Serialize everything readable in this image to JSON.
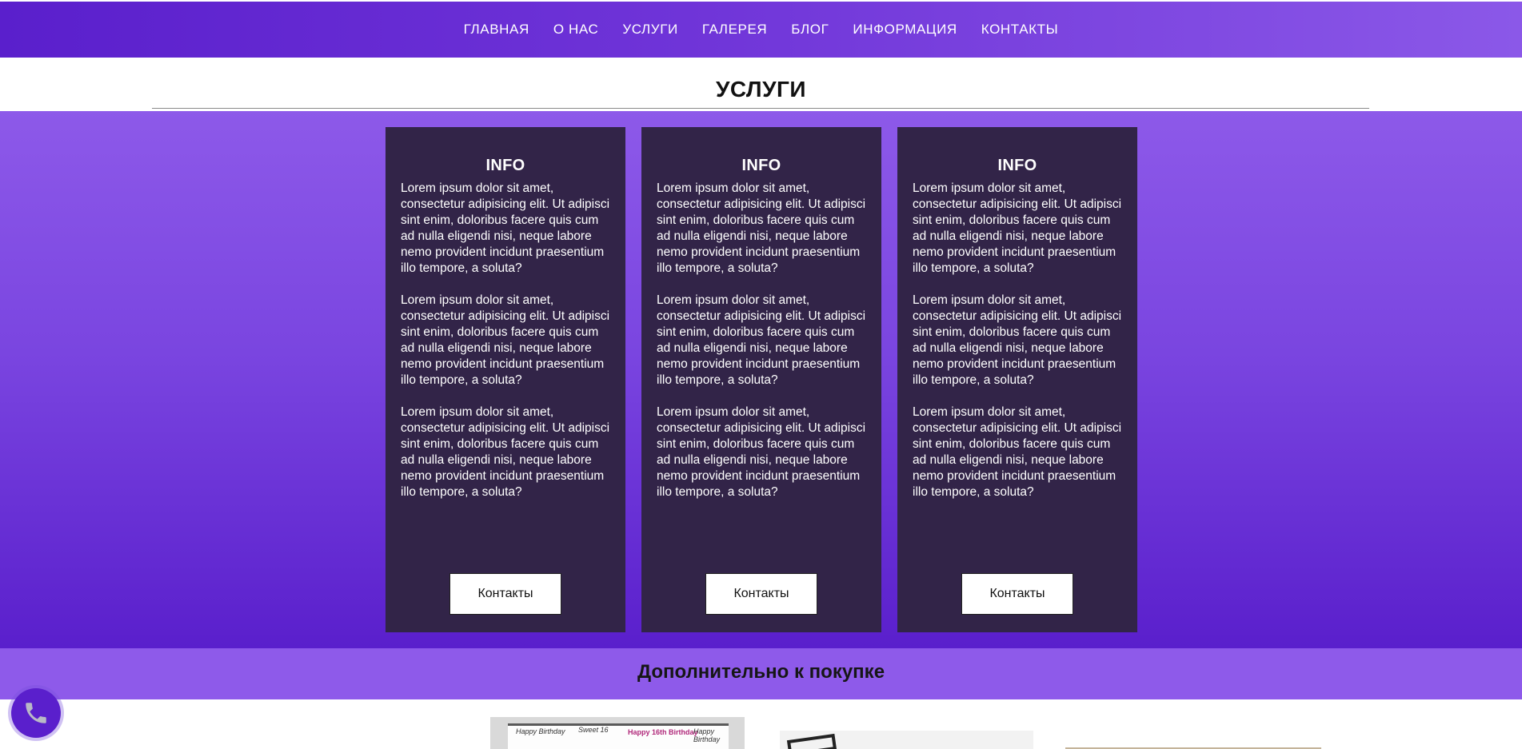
{
  "nav": {
    "items": [
      "ГЛАВНАЯ",
      "О НАС",
      "УСЛУГИ",
      "ГАЛЕРЕЯ",
      "БЛОГ",
      "ИНФОРМАЦИЯ",
      "КОНТАКТЫ"
    ]
  },
  "page": {
    "title": "УСЛУГИ"
  },
  "cards": [
    {
      "title": "INFO",
      "paragraphs": [
        "Lorem ipsum dolor sit amet, consectetur adipisicing elit. Ut adipisci sint enim, doloribus facere quis cum ad nulla eligendi nisi, neque labore nemo provident incidunt praesentium illo tempore, a soluta?",
        "Lorem ipsum dolor sit amet, consectetur adipisicing elit. Ut adipisci sint enim, doloribus facere quis cum ad nulla eligendi nisi, neque labore nemo provident incidunt praesentium illo tempore, a soluta?",
        "Lorem ipsum dolor sit amet, consectetur adipisicing elit. Ut adipisci sint enim, doloribus facere quis cum ad nulla eligendi nisi, neque labore nemo provident incidunt praesentium illo tempore, a soluta?"
      ],
      "button": "Контакты"
    },
    {
      "title": "INFO",
      "paragraphs": [
        "Lorem ipsum dolor sit amet, consectetur adipisicing elit. Ut adipisci sint enim, doloribus facere quis cum ad nulla eligendi nisi, neque labore nemo provident incidunt praesentium illo tempore, a soluta?",
        "Lorem ipsum dolor sit amet, consectetur adipisicing elit. Ut adipisci sint enim, doloribus facere quis cum ad nulla eligendi nisi, neque labore nemo provident incidunt praesentium illo tempore, a soluta?",
        "Lorem ipsum dolor sit amet, consectetur adipisicing elit. Ut adipisci sint enim, doloribus facere quis cum ad nulla eligendi nisi, neque labore nemo provident incidunt praesentium illo tempore, a soluta?"
      ],
      "button": "Контакты"
    },
    {
      "title": "INFO",
      "paragraphs": [
        "Lorem ipsum dolor sit amet, consectetur adipisicing elit. Ut adipisci sint enim, doloribus facere quis cum ad nulla eligendi nisi, neque labore nemo provident incidunt praesentium illo tempore, a soluta?",
        "Lorem ipsum dolor sit amet, consectetur adipisicing elit. Ut adipisci sint enim, doloribus facere quis cum ad nulla eligendi nisi, neque labore nemo provident incidunt praesentium illo tempore, a soluta?",
        "Lorem ipsum dolor sit amet, consectetur adipisicing elit. Ut adipisci sint enim, doloribus facere quis cum ad nulla eligendi nisi, neque labore nemo provident incidunt praesentium illo tempore, a soluta?"
      ],
      "button": "Контакты"
    }
  ],
  "extras": {
    "title": "Дополнительно к покупке",
    "thumb1_text": [
      "Happy Birthday",
      "Sweet 16",
      "Happy 16th Birthday",
      "Happy Birthday"
    ]
  },
  "call_button": {
    "icon": "phone-icon"
  },
  "colors": {
    "nav_gradient_start": "#5a1fcc",
    "nav_gradient_end": "#8b58e8",
    "card_bg": "#322448",
    "extras_band": "#8e5aea",
    "call_button": "#5a1fcc"
  }
}
